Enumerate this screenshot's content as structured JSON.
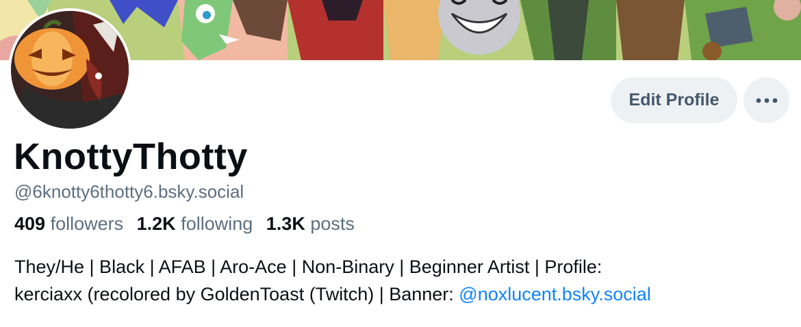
{
  "profile": {
    "display_name": "KnottyThotty",
    "handle": "@6knotty6thotty6.bsky.social",
    "stats": {
      "followers_count": "409",
      "followers_label": "followers",
      "following_count": "1.2K",
      "following_label": "following",
      "posts_count": "1.3K",
      "posts_label": "posts"
    },
    "bio": {
      "line1": "They/He | Black | AFAB | Aro-Ace | Non-Binary | Beginner Artist | Profile:",
      "line2_text": "kerciaxx (recolored by GoldenToast (Twitch) | Banner: ",
      "line2_link": "@noxlucent.bsky.social"
    }
  },
  "actions": {
    "edit_profile_label": "Edit Profile",
    "more_icon": "ellipsis-icon"
  },
  "colors": {
    "accent_link": "#1083fe",
    "secondary_text": "#5d6e80",
    "button_bg": "#eef1f4"
  }
}
